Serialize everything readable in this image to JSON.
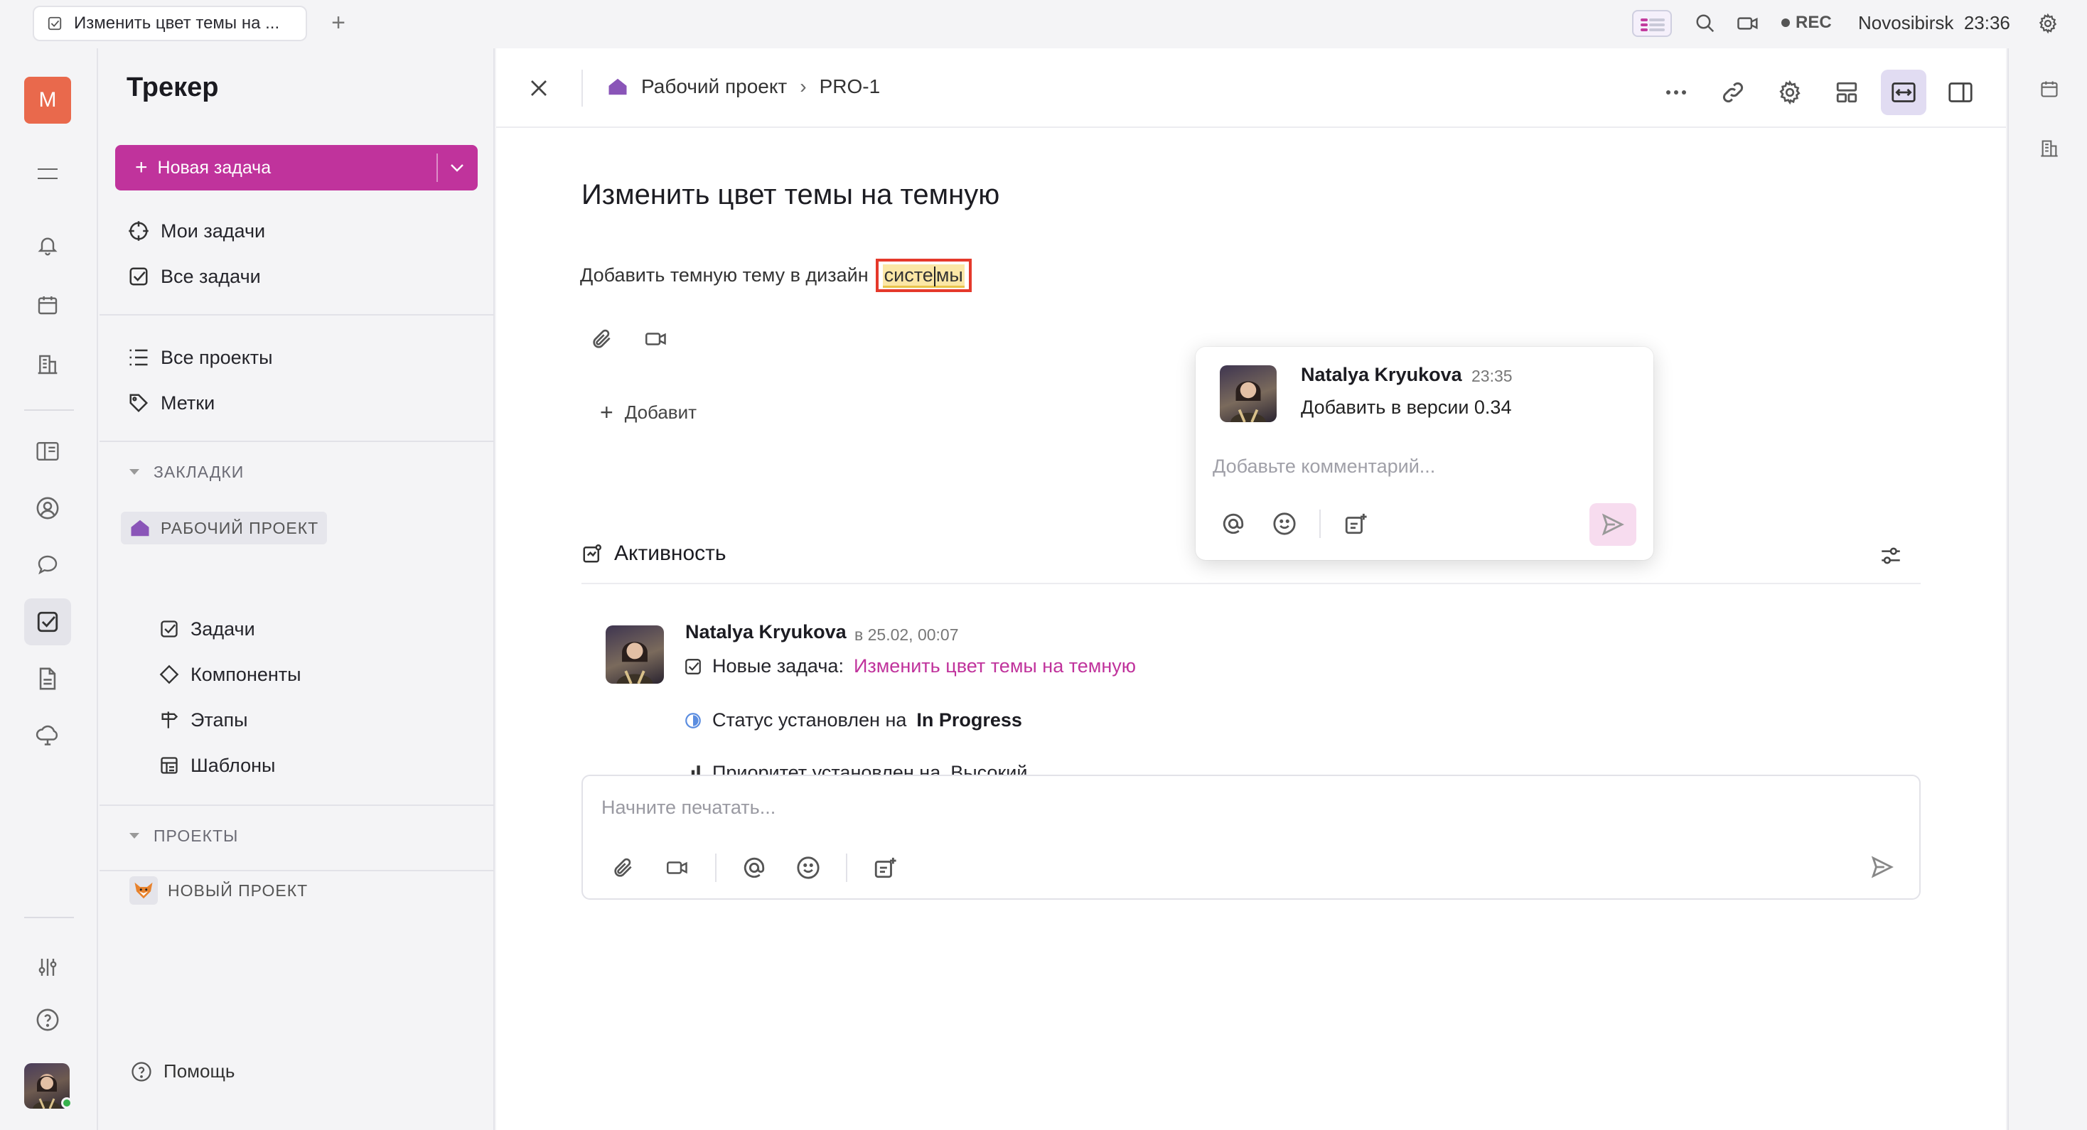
{
  "tab": {
    "title": "Изменить цвет темы на ..."
  },
  "topbar": {
    "rec": "REC",
    "city": "Novosibirsk",
    "time": "23:36"
  },
  "rail": {
    "avatar_letter": "M"
  },
  "sidebar": {
    "title": "Трекер",
    "new_task": "Новая задача",
    "my_tasks": "Мои задачи",
    "all_tasks": "Все задачи",
    "all_projects": "Все проекты",
    "labels": "Метки",
    "bookmarks": "ЗАКЛАДКИ",
    "work_project": "РАБОЧИЙ ПРОЕКТ",
    "items": [
      "Задачи",
      "Компоненты",
      "Этапы",
      "Шаблоны"
    ],
    "projects": "ПРОЕКТЫ",
    "new_project": "НОВЫЙ ПРОЕКТ",
    "help": "Помощь"
  },
  "panel": {
    "breadcrumb_project": "Рабочий проект",
    "breadcrumb_sep": "›",
    "breadcrumb_issue": "PRO-1",
    "title": "Изменить цвет темы на темную",
    "desc_prefix": "Добавить темную тему в дизайн",
    "desc_word_a": "систе",
    "desc_word_b": "мы",
    "add_subtask": "Добавит"
  },
  "popup": {
    "author": "Natalya Kryukova",
    "time": "23:35",
    "text": "Добавить в версии 0.34",
    "placeholder": "Добавьте комментарий..."
  },
  "activity": {
    "title": "Активность",
    "author": "Natalya Kryukova",
    "date": "в 25.02, 00:07",
    "new_task_label": "Новые задача:",
    "new_task_link": "Изменить цвет темы на темную",
    "status_label": "Статус установлен на",
    "status_value": "In Progress",
    "priority_label": "Приоритет установлен на",
    "priority_value": "Высокий"
  },
  "composer": {
    "placeholder": "Начните печатать..."
  },
  "colors": {
    "accent": "#c0339c",
    "highlight_box": "#e5392b",
    "avatar_m": "#e9694c"
  }
}
